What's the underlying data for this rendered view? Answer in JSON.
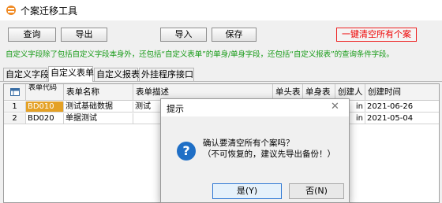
{
  "window": {
    "title": "个案迁移工具",
    "icon": "app-icon"
  },
  "toolbar": {
    "query": "查询",
    "export": "导出",
    "import": "导入",
    "save": "保存",
    "clear_all": "一键清空所有个案"
  },
  "hint": "自定义字段除了包括自定义字段本身外，还包括“自定义表单”的单身/单身字段，还包括“自定义报表”的查询条件字段。",
  "tabs": [
    "自定义字段",
    "自定义表单",
    "自定义报表",
    "外挂程序接口"
  ],
  "active_tab": 1,
  "grid": {
    "headers": {
      "code": "表单代码",
      "name": "表单名称",
      "desc": "表单描述",
      "head_table": "单头表",
      "body_table": "单身表",
      "creator": "创建人",
      "created": "创建时间"
    },
    "rows": [
      {
        "num": "1",
        "code": "BD010",
        "name": "测试基础数据",
        "desc": "测试",
        "creator": "in",
        "created": "2021-06-26"
      },
      {
        "num": "2",
        "code": "BD020",
        "name": "单据测试",
        "desc": "",
        "creator": "in",
        "created": "2021-05-04"
      }
    ]
  },
  "dialog": {
    "title": "提示",
    "icon": "question-icon",
    "message": "确认要清空所有个案吗？",
    "note": "（不可恢复的，建议先导出备份！）",
    "yes": "是(Y)",
    "no": "否(N)"
  },
  "colors": {
    "hint": "#1a9c1a",
    "clear_button": "#e00000",
    "selected_cell": "#e4a126",
    "question_icon": "#1f6fc6"
  }
}
